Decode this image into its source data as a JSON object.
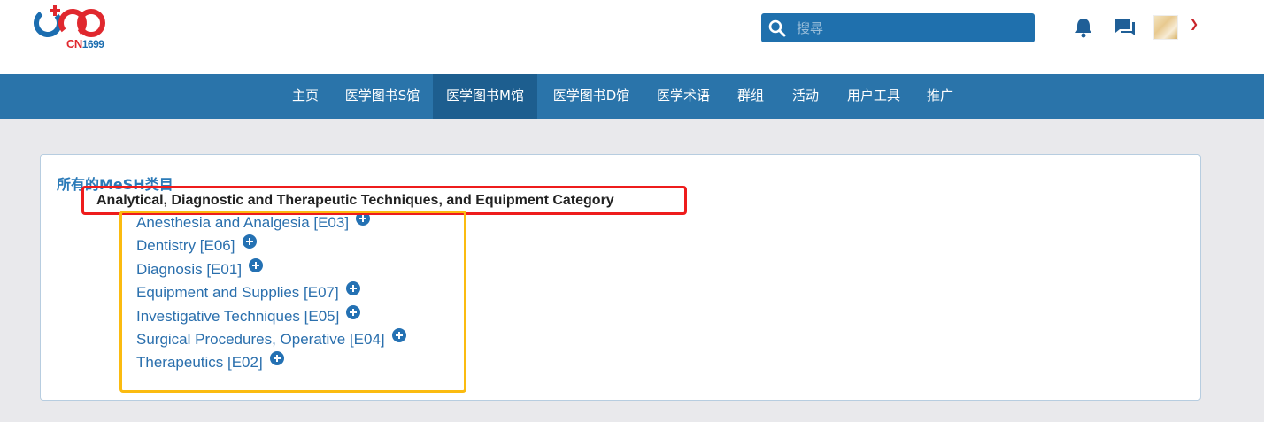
{
  "header": {
    "logo_text_prefix": "CN",
    "logo_text_number": "1699",
    "search": {
      "placeholder": "搜尋",
      "value": ""
    }
  },
  "nav": {
    "items": [
      {
        "label": "主页"
      },
      {
        "label": "医学图书S馆"
      },
      {
        "label": "医学图书M馆",
        "active": true
      },
      {
        "label": "医学图书D馆"
      },
      {
        "label": "医学术语"
      },
      {
        "label": "群组"
      },
      {
        "label": "活动"
      },
      {
        "label": "用户工具"
      },
      {
        "label": "推广"
      }
    ]
  },
  "panel": {
    "title": "所有的MeSH类目",
    "category": "Analytical, Diagnostic and Therapeutic Techniques, and Equipment Category",
    "items": [
      {
        "label": "Anesthesia and Analgesia [E03]"
      },
      {
        "label": "Dentistry [E06]"
      },
      {
        "label": "Diagnosis [E01]"
      },
      {
        "label": "Equipment and Supplies [E07]"
      },
      {
        "label": "Investigative Techniques [E05]"
      },
      {
        "label": "Surgical Procedures, Operative [E04]"
      },
      {
        "label": "Therapeutics [E02]"
      }
    ]
  },
  "colors": {
    "nav_bg": "#2a74aa",
    "nav_active_bg": "#1d5e8f",
    "link": "#2a6fad",
    "annotation_red": "#ee1c1c",
    "annotation_yellow": "#fbbb10"
  }
}
